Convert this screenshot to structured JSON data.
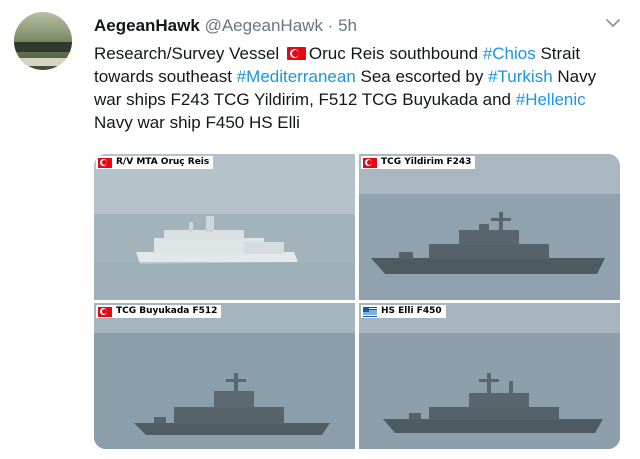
{
  "user": {
    "name": "AegeanHawk",
    "handle": "@AegeanHawk",
    "separator": "·",
    "time": "5h"
  },
  "tweet": {
    "t1": "Research/Survey Vessel ",
    "t2": "Oruc Reis southbound ",
    "h1": "#Chios",
    "t3": " Strait towards southeast ",
    "h2": "#Mediterranean",
    "t4": " Sea escorted by ",
    "h3": "#Turkish",
    "t5": " Navy war ships F243 TCG Yildirim, F512 TCG Buyukada and ",
    "h4": "#Hellenic",
    "t6": " Navy war ship F450 HS Elli"
  },
  "photos": [
    {
      "caption": "R/V MTA Oruç Reis",
      "flag": "turkey"
    },
    {
      "caption": "TCG Yildirim F243",
      "flag": "turkey"
    },
    {
      "caption": "TCG Buyukada F512",
      "flag": "turkey"
    },
    {
      "caption": "HS Elli F450",
      "flag": "greece"
    }
  ],
  "colors": {
    "link": "#1b95e0",
    "muted": "#657786",
    "text": "#14171a"
  }
}
